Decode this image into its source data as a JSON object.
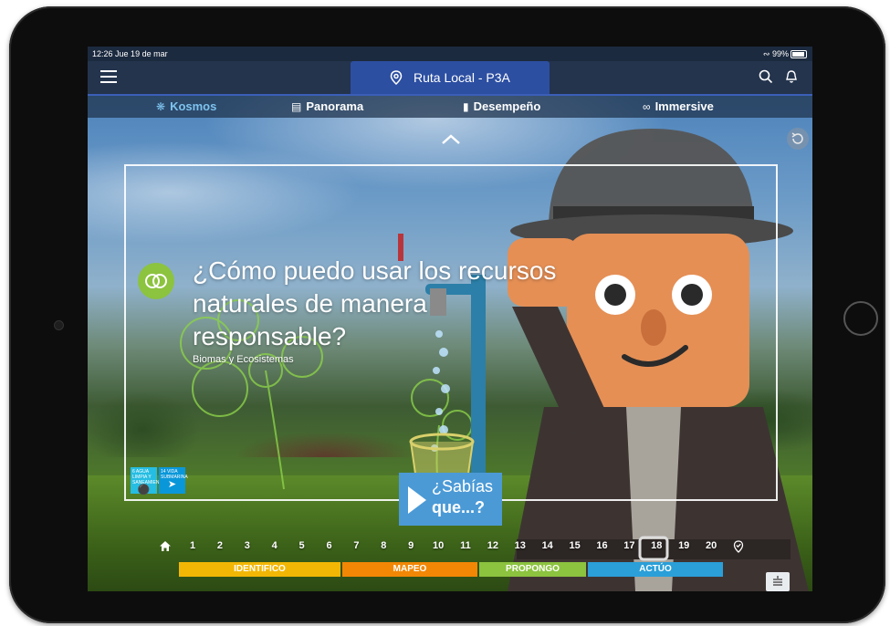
{
  "status": {
    "time": "12:26",
    "date": "Jue 19 de mar",
    "battery": "99%"
  },
  "header": {
    "route_title": "Ruta Local - P3A"
  },
  "nav": [
    {
      "label": "Kosmos",
      "icon": "kosmos-icon"
    },
    {
      "label": "Panorama",
      "icon": "panorama-icon"
    },
    {
      "label": "Desempeño",
      "icon": "chart-icon"
    },
    {
      "label": "Immersive",
      "icon": "binoculars-icon"
    }
  ],
  "question": {
    "title": "¿Cómo puedo usar los recursos naturales de manera responsable?",
    "subtitle": "Biomas y Ecosistemas"
  },
  "sdg": [
    {
      "number": "6",
      "label": "AGUA LIMPIA Y SANEAMIENTO",
      "color": "#26bde2"
    },
    {
      "number": "14",
      "label": "VIDA SUBMARINA",
      "color": "#0a97d9"
    }
  ],
  "sabias": {
    "line1": "¿Sabías",
    "line2": "que...?"
  },
  "pages": [
    "1",
    "2",
    "3",
    "4",
    "5",
    "6",
    "7",
    "8",
    "9",
    "10",
    "11",
    "12",
    "13",
    "14",
    "15",
    "16",
    "17",
    "18",
    "19",
    "20"
  ],
  "phases": [
    {
      "label": "IDENTIFICO",
      "color": "#f2b705"
    },
    {
      "label": "MAPEO",
      "color": "#f28705"
    },
    {
      "label": "PROPONGO",
      "color": "#8cc33f"
    },
    {
      "label": "ACTÚO",
      "color": "#2a9fd8"
    }
  ]
}
